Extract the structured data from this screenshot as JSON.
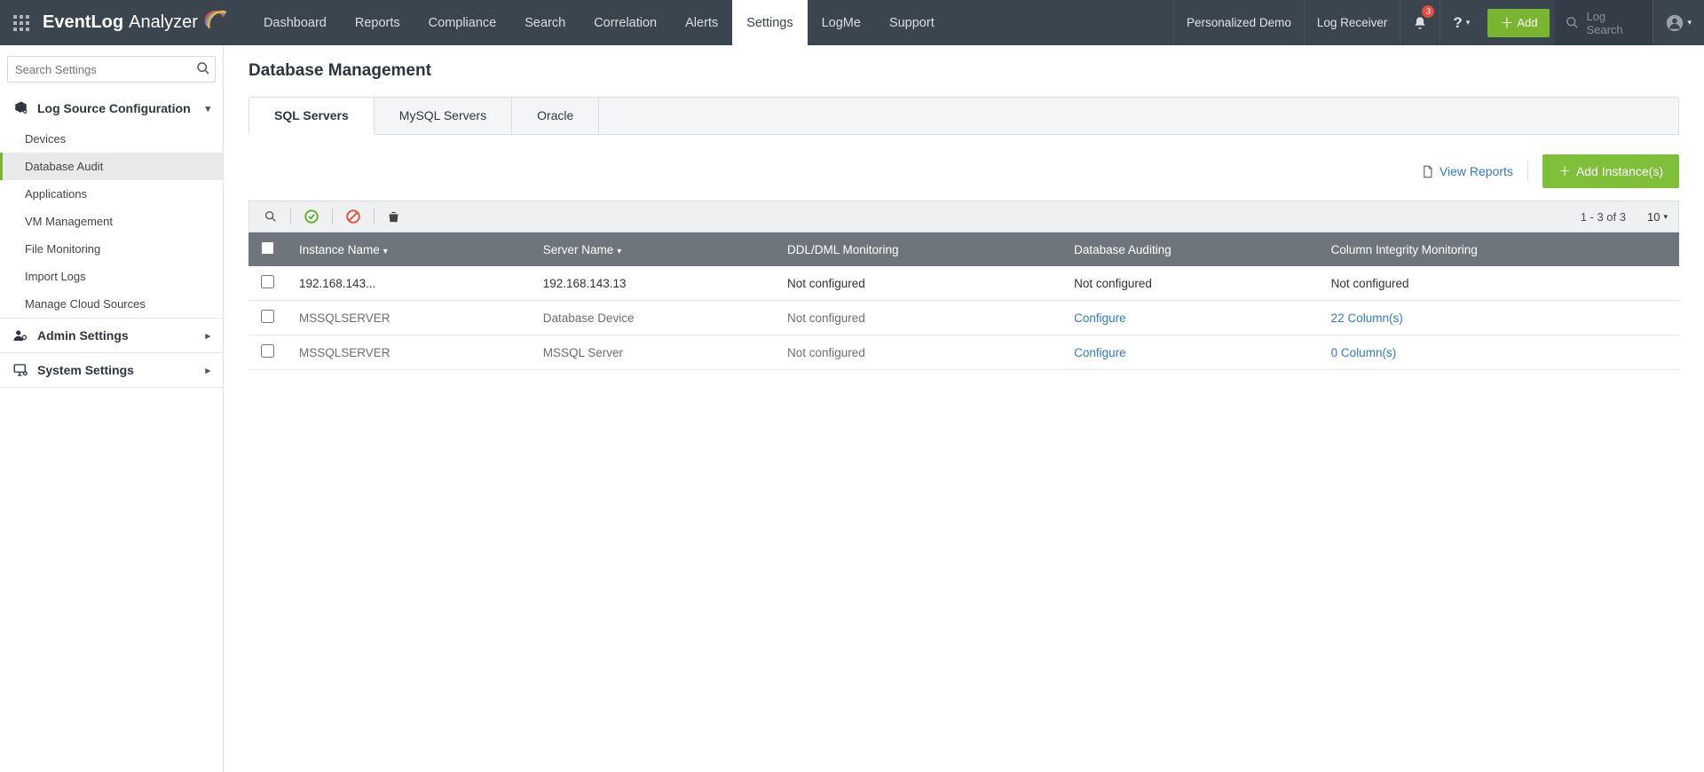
{
  "topbar": {
    "product": {
      "bold": "EventLog",
      "light": "Analyzer"
    },
    "nav": [
      "Dashboard",
      "Reports",
      "Compliance",
      "Search",
      "Correlation",
      "Alerts",
      "Settings",
      "LogMe",
      "Support"
    ],
    "nav_active": 6,
    "links": {
      "demo": "Personalized Demo",
      "receiver": "Log Receiver"
    },
    "alerts_badge": "3",
    "add_label": "Add",
    "logsearch_placeholder": "Log Search"
  },
  "sidebar": {
    "search_placeholder": "Search Settings",
    "sections": [
      {
        "title": "Log Source Configuration",
        "open": true,
        "items": [
          "Devices",
          "Database Audit",
          "Applications",
          "VM Management",
          "File Monitoring",
          "Import Logs",
          "Manage Cloud Sources"
        ],
        "active": 1
      },
      {
        "title": "Admin Settings",
        "open": false
      },
      {
        "title": "System Settings",
        "open": false
      }
    ]
  },
  "main": {
    "title": "Database Management",
    "tabs": [
      "SQL Servers",
      "MySQL Servers",
      "Oracle"
    ],
    "tab_active": 0,
    "view_reports": "View Reports",
    "add_instance": "Add Instance(s)",
    "page_info": "1 - 3 of 3",
    "per_page": "10",
    "columns": [
      "Instance Name",
      "Server Name",
      "DDL/DML Monitoring",
      "Database Auditing",
      "Column Integrity Monitoring"
    ],
    "rows": [
      {
        "instance": "192.168.143...",
        "server": "192.168.143.13",
        "ddl": "Not configured",
        "audit": "Not configured",
        "audit_link": false,
        "cim": "Not configured",
        "cim_link": false,
        "selected": true
      },
      {
        "instance": "MSSQLSERVER",
        "server": "Database Device",
        "ddl": "Not configured",
        "audit": "Configure",
        "audit_link": true,
        "cim": "22 Column(s)",
        "cim_link": true,
        "selected": false
      },
      {
        "instance": "MSSQLSERVER",
        "server": "MSSQL Server",
        "ddl": "Not configured",
        "audit": "Configure",
        "audit_link": true,
        "cim": "0 Column(s)",
        "cim_link": true,
        "selected": false
      }
    ]
  }
}
